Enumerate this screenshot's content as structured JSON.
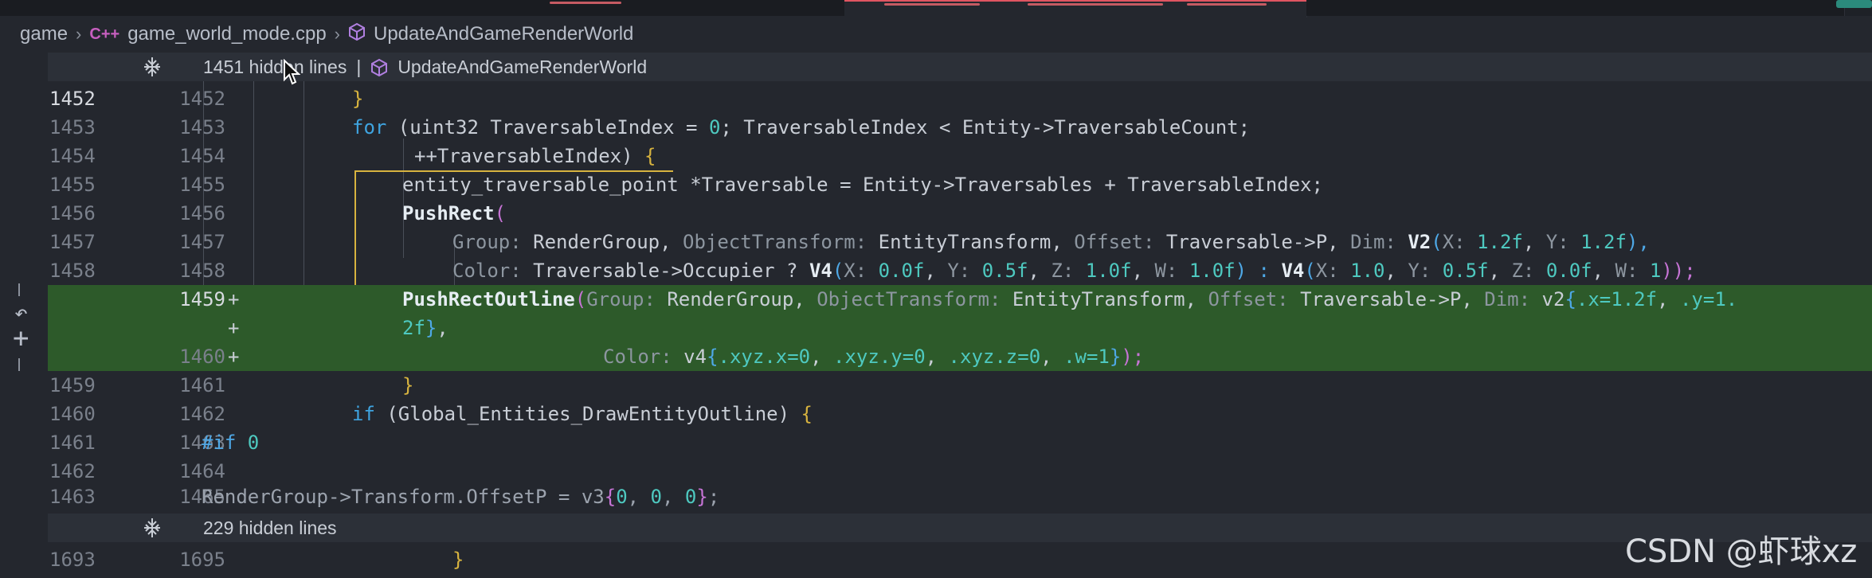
{
  "breadcrumb": {
    "root": "game",
    "file_icon": "C++",
    "file": "game_world_mode.cpp",
    "symbol": "UpdateAndGameRenderWorld"
  },
  "fold_top": {
    "label": "1451 hidden lines",
    "separator": "|",
    "symbol": "UpdateAndGameRenderWorld"
  },
  "fold_bottom": {
    "label": "229 hidden lines"
  },
  "lines": [
    {
      "old": "1452",
      "new": "1452"
    },
    {
      "old": "1453",
      "new": "1453"
    },
    {
      "old": "1454",
      "new": "1454"
    },
    {
      "old": "1455",
      "new": "1455"
    },
    {
      "old": "1456",
      "new": "1456"
    },
    {
      "old": "1457",
      "new": "1457"
    },
    {
      "old": "1458",
      "new": "1458"
    },
    {
      "old": "",
      "new": "1459",
      "plus": "+"
    },
    {
      "old": "",
      "new": "",
      "plus": "+"
    },
    {
      "old": "",
      "new": "1460",
      "plus": "+"
    },
    {
      "old": "1459",
      "new": "1461"
    },
    {
      "old": "1460",
      "new": "1462"
    },
    {
      "old": "1461",
      "new": "1463"
    },
    {
      "old": "1462",
      "new": "1464"
    },
    {
      "old": "1463",
      "new": "1465"
    },
    {
      "old": "1693",
      "new": "1695"
    }
  ],
  "code": {
    "l1452": "}",
    "l1453": {
      "kw": "for",
      "a": " (uint32 TraversableIndex = ",
      "n": "0",
      "b": "; TraversableIndex < Entity->TraversableCount;"
    },
    "l1454": {
      "a": "++TraversableIndex) ",
      "brace": "{"
    },
    "l1455": {
      "a": "entity_traversable_point ",
      "b": "*Traversable = Entity->Traversables + TraversableIndex;"
    },
    "l1456": {
      "fn": "PushRect",
      "p": "("
    },
    "l1457": {
      "h1": "Group:",
      "v1": " RenderGroup, ",
      "h2": "ObjectTransform:",
      "v2": " EntityTransform, ",
      "h3": "Offset:",
      "v3": " Traversable->P, ",
      "h4": "Dim:",
      "fn": " V2",
      "p": "(",
      "h5": "X:",
      "n1": " 1.2f",
      "c": ", ",
      "h6": "Y:",
      "n2": " 1.2f",
      "e": "),"
    },
    "l1458": {
      "h1": "Color:",
      "v1": " Traversable->Occupier ? ",
      "fn1": "V4",
      "p1": "(",
      "h2": "X:",
      "n1": " 0.0f",
      "c1": ", ",
      "h3": "Y:",
      "n2": " 0.5f",
      "c2": ", ",
      "h4": "Z:",
      "n3": " 1.0f",
      "c3": ", ",
      "h5": "W:",
      "n4": " 1.0f",
      "m": ") : ",
      "fn2": "V4",
      "p2": "(",
      "h6": "X:",
      "n5": " 1.0",
      "c4": ", ",
      "h7": "Y:",
      "n6": " 0.5f",
      "c5": ", ",
      "h8": "Z:",
      "n7": " 0.0f",
      "c6": ", ",
      "h9": "W:",
      "n8": " 1",
      "e": "));"
    },
    "l1459n": {
      "fn": "PushRectOutline",
      "p": "(",
      "h1": "Group:",
      "v1": " RenderGroup, ",
      "h2": "ObjectTransform:",
      "v2": " EntityTransform, ",
      "h3": "Offset:",
      "v3": " Traversable->P, ",
      "h4": "Dim:",
      "v4": " v2",
      "b": "{",
      "x": ".x=",
      "n1": "1.2f",
      "c": ", ",
      "y": ".y=",
      "n2": "1."
    },
    "l1459w": {
      "n": "2f",
      "b": "}",
      "e": ","
    },
    "l1460n": {
      "h": "Color:",
      "v": " v4",
      "b": "{",
      "a1": ".xyz.x=",
      "n1": "0",
      "c1": ", ",
      "a2": ".xyz.y=",
      "n2": "0",
      "c2": ", ",
      "a3": ".xyz.z=",
      "n3": "0",
      "c3": ", ",
      "a4": ".w=",
      "n4": "1",
      "b2": "}",
      "e": ");"
    },
    "l1461n": "}",
    "l1462n": {
      "kw": "if",
      "a": " (Global_Entities_DrawEntityOutline) ",
      "brace": "{"
    },
    "l1463n": {
      "pp": "#if",
      "n": " 0"
    },
    "l1465n": {
      "a": "RenderGroup->Transform.OffsetP = v3",
      "b": "{",
      "n1": "0",
      "c1": ", ",
      "n2": "0",
      "c2": ", ",
      "n3": "0",
      "b2": "}",
      "e": ";"
    },
    "l1695n": "}"
  },
  "watermark": "CSDN @虾球xz",
  "colors": {
    "added_bg": "#2d5a2a",
    "keyword": "#3fa4e0",
    "number": "#4ec9c0",
    "bracket": "#d7b33f"
  }
}
